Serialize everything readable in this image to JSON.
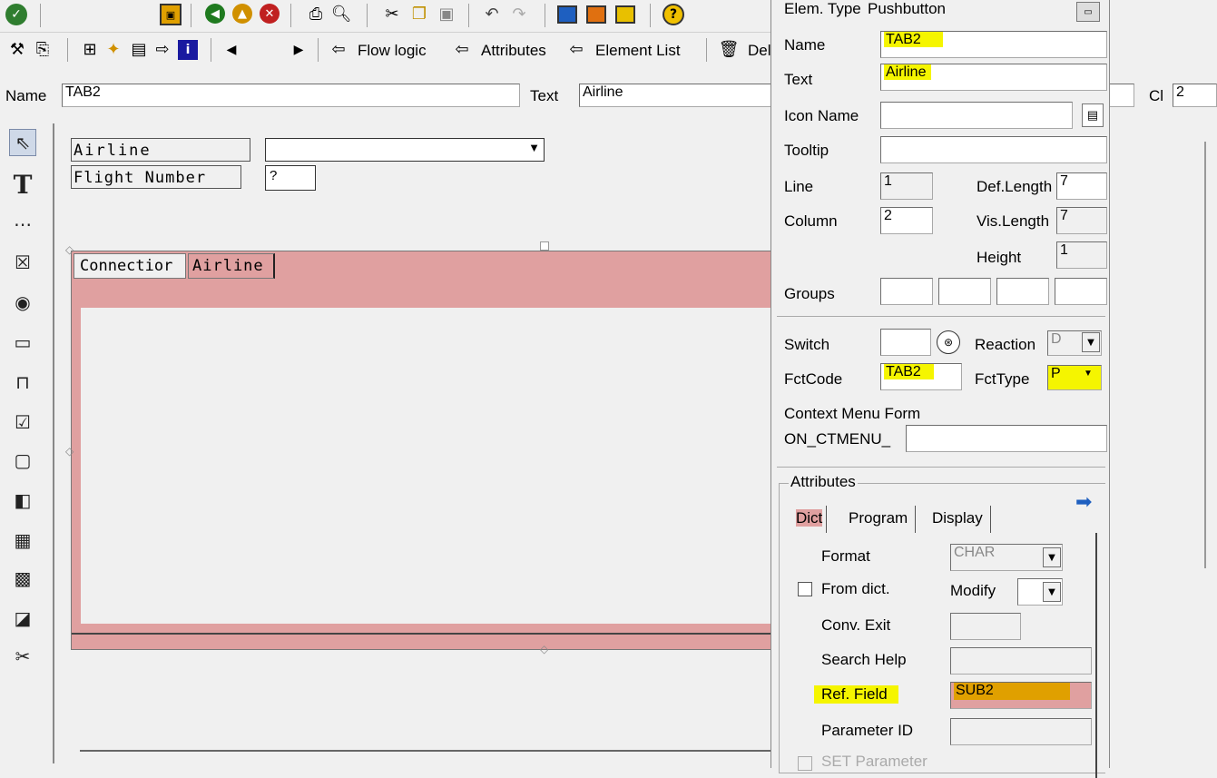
{
  "toolbar1": {
    "icons": [
      "check-icon",
      "save-icon",
      "back-icon",
      "exit-icon",
      "cancel-icon",
      "print-icon",
      "find-icon",
      "cut-icon",
      "copy-icon",
      "paste-icon",
      "undo-icon",
      "redo-icon",
      "layout-icon",
      "layout2-icon",
      "layout3-icon",
      "help-icon"
    ]
  },
  "toolbar2": {
    "flow_logic": "Flow logic",
    "attributes": "Attributes",
    "element_list": "Element List",
    "delete_partial": "Del"
  },
  "namebar": {
    "name_label": "Name",
    "name_value": "TAB2",
    "text_label": "Text",
    "text_value": "Airline",
    "cl_label": "Cl",
    "cl_value": "2"
  },
  "canvas": {
    "airline_label": "Airline",
    "flight_number_label": "Flight Number",
    "flight_number_value": "?",
    "tabs": [
      "Connectior",
      "Airline"
    ]
  },
  "props": {
    "elem_type_label": "Elem. Type",
    "elem_type_value": "Pushbutton",
    "name_label": "Name",
    "name_value": "TAB2",
    "text_label": "Text",
    "text_value": "Airline",
    "icon_name_label": "Icon Name",
    "tooltip_label": "Tooltip",
    "line_label": "Line",
    "line_value": "1",
    "def_length_label": "Def.Length",
    "def_length_value": "7",
    "column_label": "Column",
    "column_value": "2",
    "vis_length_label": "Vis.Length",
    "vis_length_value": "7",
    "height_label": "Height",
    "height_value": "1",
    "groups_label": "Groups",
    "switch_label": "Switch",
    "reaction_label": "Reaction",
    "reaction_value": "D",
    "fctcode_label": "FctCode",
    "fctcode_value": "TAB2",
    "fcttype_label": "FctType",
    "fcttype_value": "P",
    "context_menu_label": "Context Menu Form",
    "on_ctmenu_label": "ON_CTMENU_"
  },
  "attributes": {
    "group_title": "Attributes",
    "tabs": [
      "Dict",
      "Program",
      "Display"
    ],
    "format_label": "Format",
    "format_value": "CHAR",
    "from_dict_label": "From dict.",
    "modify_label": "Modify",
    "conv_exit_label": "Conv. Exit",
    "search_help_label": "Search Help",
    "ref_field_label": "Ref. Field",
    "ref_field_value": "SUB2",
    "parameter_id_label": "Parameter ID",
    "set_parameter_label": "SET Parameter"
  },
  "palette": [
    "pointer-icon",
    "text-field-icon",
    "input-field-icon",
    "checkbox-icon",
    "radio-button-icon",
    "pushbutton-icon",
    "frame-icon",
    "tabstrip-icon",
    "subscreen-icon",
    "table-control-icon",
    "table-wizard-icon",
    "custom-control-icon",
    "status-icon",
    "tabstrip-wizard-icon"
  ],
  "colors": {
    "highlight": "#f5f500",
    "tab_pink": "#e0a0a0",
    "ref_fill": "#e0a000"
  }
}
